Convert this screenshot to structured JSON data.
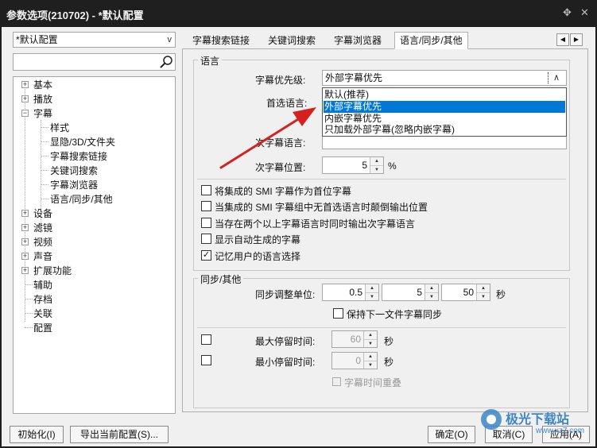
{
  "window": {
    "title": "参数选项(210702) - *默认配置",
    "pin_icon": "pin-icon",
    "close_icon": "close-icon"
  },
  "left": {
    "profile_combo": "*默认配置",
    "search_placeholder": "",
    "tree": {
      "n0": "基本",
      "n1": "播放",
      "n2": "字幕",
      "c0": "样式",
      "c1": "显隐/3D/文件夹",
      "c2": "字幕搜索链接",
      "c3": "关键词搜索",
      "c4": "字幕浏览器",
      "c5": "语言/同步/其他",
      "n3": "设备",
      "n4": "滤镜",
      "n5": "视频",
      "n6": "声音",
      "n7": "扩展功能",
      "n8": "辅助",
      "n9": "存档",
      "n10": "关联",
      "n11": "配置"
    }
  },
  "tabs": {
    "t0": "字幕搜索链接",
    "t1": "关键词搜索",
    "t2": "字幕浏览器",
    "t3": "语言/同步/其他"
  },
  "language": {
    "group_label": "语言",
    "priority_label": "字幕优先级:",
    "priority_value": "外部字幕优先",
    "preferred_label": "首选语言:",
    "secondary_label": "次字幕语言:",
    "secondary_pos_label": "次字幕位置:",
    "secondary_pos_value": "5",
    "percent": "%",
    "dropdown": {
      "o0": "默认(推荐)",
      "o1": "外部字幕优先",
      "o2": "内嵌字幕优先",
      "o3": "只加载外部字幕(忽略内嵌字幕)"
    },
    "checks": {
      "c0": {
        "label": "将集成的 SMI 字幕作为首位字幕",
        "checked": false
      },
      "c1": {
        "label": "当集成的 SMI 字幕组中无首选语言时颠倒输出位置",
        "checked": false
      },
      "c2": {
        "label": "当存在两个以上字幕语言时同时输出次字幕语言",
        "checked": false
      },
      "c3": {
        "label": "显示自动生成的字幕",
        "checked": false
      },
      "c4": {
        "label": "记忆用户的语言选择",
        "checked": true
      }
    }
  },
  "sync": {
    "group_label": "同步/其他",
    "unit_label": "同步调整单位:",
    "v1": "0.5",
    "v2": "5",
    "v3": "50",
    "sec": "秒",
    "keep_sync_label": "保持下一文件字幕同步",
    "max_label": "最大停留时间:",
    "max_value": "60",
    "min_label": "最小停留时间:",
    "min_value": "0",
    "overlap_label": "字幕时间重叠"
  },
  "buttons": {
    "init": "初始化(I)",
    "export": "导出当前配置(S)...",
    "ok": "确定(O)",
    "cancel": "取消(C)",
    "apply": "应用(A)"
  },
  "watermark": {
    "text": "极光下载站",
    "sub": "www.xz7.com"
  },
  "colors": {
    "selection": "#0078d7",
    "annotation_arrow": "#d62020"
  }
}
